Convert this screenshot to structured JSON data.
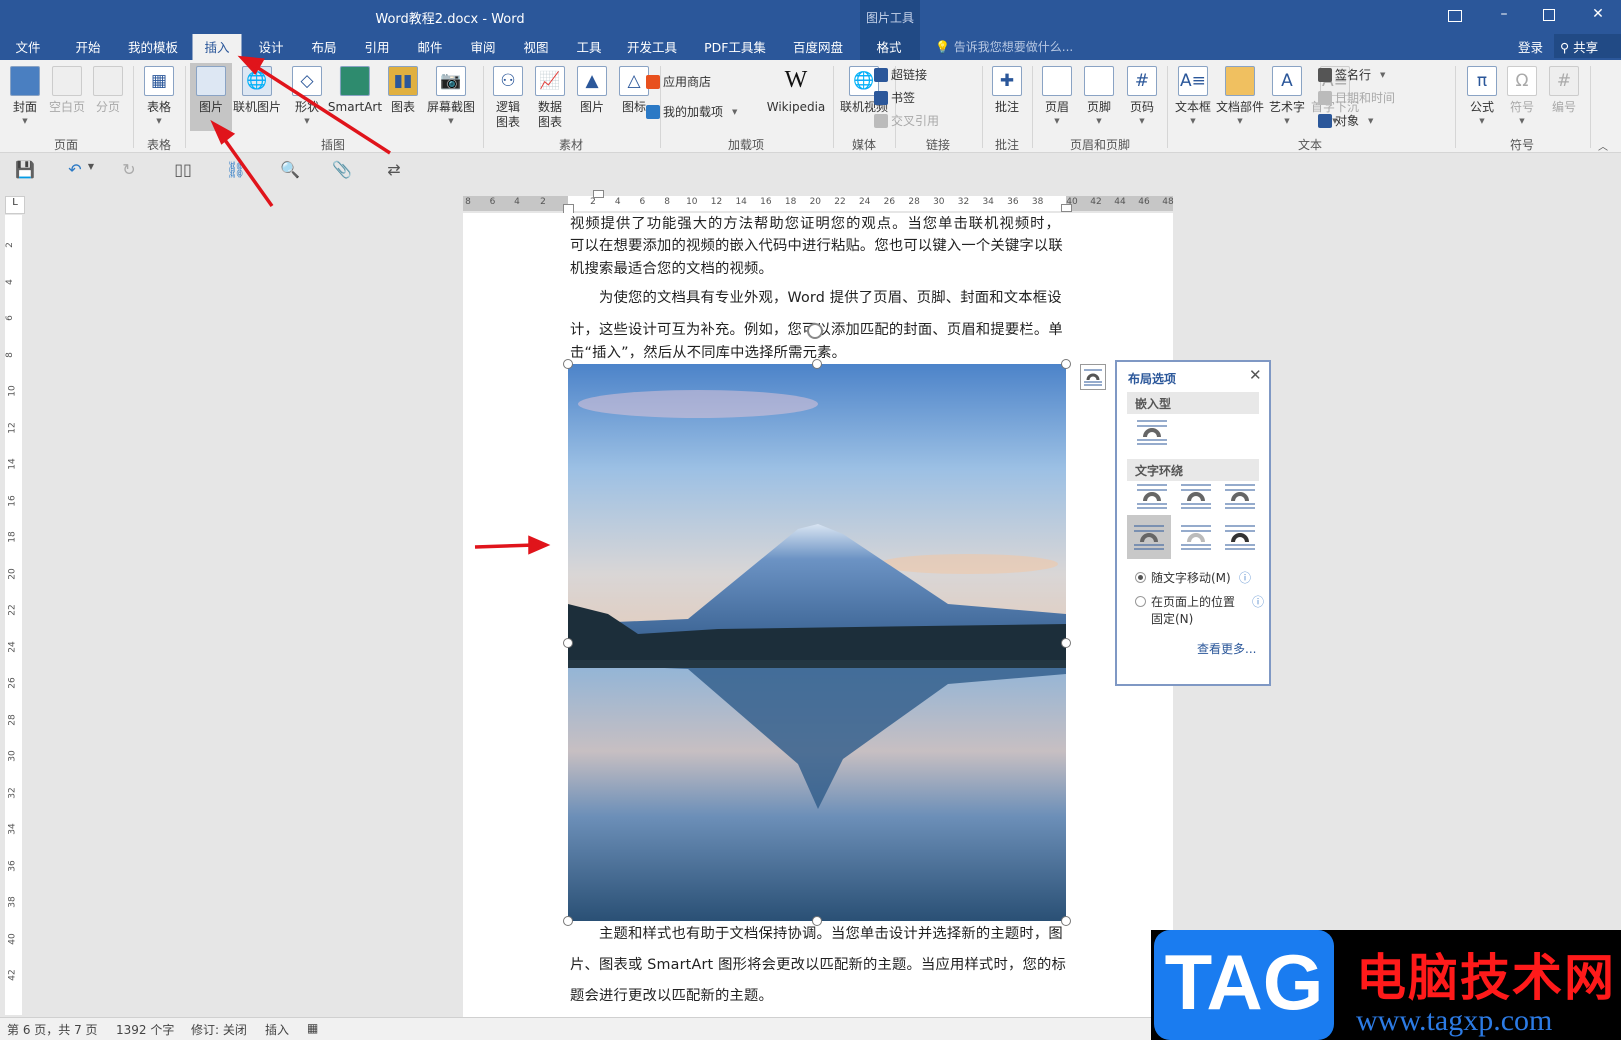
{
  "window": {
    "title": "Word教程2.docx - Word",
    "context_group": "图片工具",
    "controls": [
      "restore-ribbon",
      "minimize",
      "maximize",
      "close"
    ]
  },
  "tabs": [
    {
      "label": "文件"
    },
    {
      "label": "开始"
    },
    {
      "label": "我的模板"
    },
    {
      "label": "插入",
      "active": true
    },
    {
      "label": "设计"
    },
    {
      "label": "布局"
    },
    {
      "label": "引用"
    },
    {
      "label": "邮件"
    },
    {
      "label": "审阅"
    },
    {
      "label": "视图"
    },
    {
      "label": "工具"
    },
    {
      "label": "开发工具"
    },
    {
      "label": "PDF工具集"
    },
    {
      "label": "百度网盘"
    },
    {
      "label": "格式"
    }
  ],
  "tell_me": "告诉我您想要做什么...",
  "account": {
    "signin": "登录",
    "share": "共享"
  },
  "ribbon": {
    "groups": [
      "页面",
      "表格",
      "插图",
      "素材",
      "加载项",
      "媒体",
      "链接",
      "批注",
      "页眉和页脚",
      "文本",
      "符号"
    ],
    "big_items": [
      {
        "label": "封面",
        "icon": "cover-page-icon",
        "dropdown": true
      },
      {
        "label": "空白页",
        "icon": "blank-page-icon",
        "disabled": true
      },
      {
        "label": "分页",
        "icon": "page-break-icon",
        "disabled": true
      },
      {
        "label": "表格",
        "icon": "table-icon",
        "dropdown": true
      },
      {
        "label": "图片",
        "icon": "picture-icon",
        "selected": true
      },
      {
        "label": "联机图片",
        "icon": "online-picture-icon"
      },
      {
        "label": "形状",
        "icon": "shapes-icon",
        "dropdown": true
      },
      {
        "label": "SmartArt",
        "icon": "smartart-icon"
      },
      {
        "label": "图表",
        "icon": "chart-icon"
      },
      {
        "label": "屏幕截图",
        "icon": "screenshot-icon",
        "dropdown": true
      },
      {
        "label": "逻辑\n图表",
        "icon": "logic-chart-icon"
      },
      {
        "label": "数据\n图表",
        "icon": "data-chart-icon"
      },
      {
        "label": "图片",
        "icon": "material-picture-icon"
      },
      {
        "label": "图标",
        "icon": "icons-icon"
      },
      {
        "label": "Wikipedia",
        "icon": "wikipedia-icon"
      },
      {
        "label": "联机视频",
        "icon": "online-video-icon"
      },
      {
        "label": "批注",
        "icon": "comment-icon"
      },
      {
        "label": "页眉",
        "icon": "header-icon",
        "dropdown": true
      },
      {
        "label": "页脚",
        "icon": "footer-icon",
        "dropdown": true
      },
      {
        "label": "页码",
        "icon": "page-number-icon",
        "dropdown": true
      },
      {
        "label": "文本框",
        "icon": "text-box-icon",
        "dropdown": true
      },
      {
        "label": "文档部件",
        "icon": "quick-parts-icon",
        "dropdown": true
      },
      {
        "label": "艺术字",
        "icon": "wordart-icon",
        "dropdown": true
      },
      {
        "label": "首字下沉",
        "icon": "drop-cap-icon",
        "dropdown": true,
        "disabled": true
      },
      {
        "label": "公式",
        "icon": "equation-icon",
        "dropdown": true
      },
      {
        "label": "符号",
        "icon": "symbol-icon",
        "dropdown": true,
        "disabled": true
      },
      {
        "label": "编号",
        "icon": "number-icon",
        "disabled": true
      }
    ],
    "small_items": [
      {
        "label": "应用商店",
        "icon": "store-icon"
      },
      {
        "label": "我的加载项",
        "icon": "my-addins-icon",
        "dropdown": true
      },
      {
        "label": "超链接",
        "icon": "hyperlink-icon"
      },
      {
        "label": "书签",
        "icon": "bookmark-icon"
      },
      {
        "label": "交叉引用",
        "icon": "cross-reference-icon",
        "disabled": true
      },
      {
        "label": "签名行",
        "icon": "signature-line-icon",
        "dropdown": true
      },
      {
        "label": "日期和时间",
        "icon": "date-time-icon",
        "disabled": true
      },
      {
        "label": "对象",
        "icon": "object-icon",
        "dropdown": true
      }
    ]
  },
  "quick_access": [
    "save-icon",
    "undo-icon",
    "redo-icon",
    "read-mode-icon",
    "link-icon",
    "print-preview-icon",
    "attach-icon",
    "convert-icon"
  ],
  "ruler": {
    "horizontal": [
      "8",
      "6",
      "4",
      "2",
      "2",
      "4",
      "6",
      "8",
      "10",
      "12",
      "14",
      "16",
      "18",
      "20",
      "22",
      "24",
      "26",
      "28",
      "30",
      "32",
      "34",
      "36",
      "38",
      "40",
      "42",
      "44",
      "46",
      "48"
    ],
    "vertical": [
      "2",
      "4",
      "6",
      "8",
      "10",
      "12",
      "14",
      "16",
      "18",
      "20",
      "22",
      "24",
      "26",
      "28",
      "30",
      "32",
      "34",
      "36",
      "38",
      "40",
      "42"
    ]
  },
  "document": {
    "lines_top": [
      {
        "text": "视频提供了功能强大的方法帮助您证明您的观点。当您单击联机视频时，",
        "cut": true
      },
      {
        "text": "可以在想要添加的视频的嵌入代码中进行粘贴。您也可以键入一个关键字以联"
      },
      {
        "text": "机搜索最适合您的文档的视频。",
        "last": true
      },
      {
        "text": "为使您的文档具有专业外观，Word 提供了页眉、页脚、封面和文本框设",
        "indent": true
      },
      {
        "text": "计，这些设计可互为补充。例如，您可以添加匹配的封面、页眉和提要栏。单"
      },
      {
        "text": "击“插入”，然后从不同库中选择所需元素。",
        "last": true
      }
    ],
    "lines_bottom": [
      {
        "text": "主题和样式也有助于文档保持协调。当您单击设计并选择新的主题时，图",
        "indent": true
      },
      {
        "text": "片、图表或 SmartArt 图形将会更改以匹配新的主题。当应用样式时，您的标"
      },
      {
        "text": "题会进行更改以匹配新的主题。",
        "last": true
      }
    ]
  },
  "layout_options": {
    "title": "布局选项",
    "inline_section": "嵌入型",
    "wrap_section": "文字环绕",
    "move_with_text": "随文字移动(M)",
    "fix_position": "在页面上的位置",
    "fix_position_2": "固定(N)",
    "see_more": "查看更多...",
    "selected_option": "move_with_text"
  },
  "status": {
    "page": "第 6 页，共 7 页",
    "words": "1392 个字",
    "track_changes": "修订: 关闭",
    "mode": "插入"
  },
  "watermark": {
    "logo": "TAG",
    "site_name": "电脑技术网",
    "url": "www.tagxp.com"
  },
  "colors": {
    "accent": "#2b579a",
    "annotation_arrow": "#e0141b"
  }
}
